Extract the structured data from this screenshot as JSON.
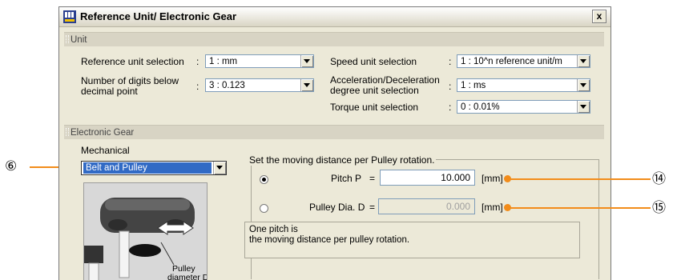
{
  "window": {
    "title": "Reference Unit/ Electronic Gear",
    "close_label": "x"
  },
  "unit_section": {
    "title": "Unit",
    "reference_unit": {
      "label": "Reference unit selection",
      "value": "1 : mm"
    },
    "digits": {
      "label_line1": "Number of digits below",
      "label_line2": "decimal point",
      "value": "3 : 0.123"
    },
    "speed_unit": {
      "label": "Speed unit selection",
      "value": "1 : 10^n reference unit/m"
    },
    "accel_unit": {
      "label_line1": "Acceleration/Deceleration",
      "label_line2": "degree unit selection",
      "value": "1 : ms"
    },
    "torque_unit": {
      "label": "Torque unit selection",
      "value": "0 : 0.01%"
    },
    "colon": ":"
  },
  "gear_section": {
    "title": "Electronic Gear",
    "mechanical_label": "Mechanical",
    "mechanical_value": "Belt and Pulley",
    "group_title": "Set the moving distance per Pulley rotation.",
    "pitch": {
      "label": "Pitch P",
      "eq": "=",
      "value": "10.000",
      "unit": "[mm]",
      "selected": true
    },
    "pulley_dia": {
      "label": "Pulley Dia. D",
      "eq": "=",
      "value": "0.000",
      "unit": "[mm]",
      "selected": false
    },
    "note_line1": "One pitch is",
    "note_line2": "the moving distance per pulley rotation.",
    "diagram_label_line1": "Pulley",
    "diagram_label_line2": "diameter D"
  },
  "callouts": {
    "mechanical": "⑥",
    "pitch": "⑭",
    "pulley_dia": "⑮"
  },
  "colors": {
    "callout": "#f28c1a",
    "window_bg": "#ece9d8",
    "section_bar": "#d8d4c4"
  }
}
